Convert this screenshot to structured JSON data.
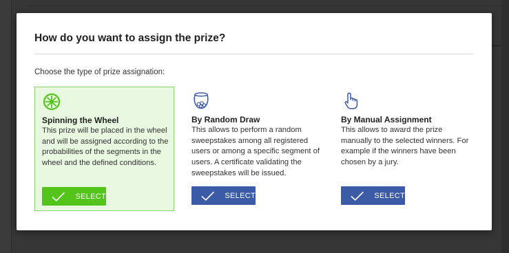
{
  "modal": {
    "title": "How do you want to assign the prize?",
    "prompt": "Choose the type of prize assignation:"
  },
  "options": [
    {
      "icon": "wheel-icon",
      "title": "Spinning the Wheel",
      "description": "This prize will be placed in the wheel and will be assigned according to the probabilities of the segments in the wheel and the defined conditions.",
      "button_label": "SELECT",
      "selected": true
    },
    {
      "icon": "draw-bowl-icon",
      "title": "By Random Draw",
      "description": "This allows to perform a random sweepstakes among all registered users or among a specific segment of users. A certificate validating the sweepstakes will be issued.",
      "button_label": "SELECT",
      "selected": false
    },
    {
      "icon": "hand-pointer-icon",
      "title": "By Manual Assignment",
      "description": "This allows to award the prize manually to the selected winners. For example if the winners have been chosen by a jury.",
      "button_label": "SELECT",
      "selected": false
    }
  ],
  "colors": {
    "selected_accent": "#52c41a",
    "selected_background": "#e8f7df",
    "selected_border": "#8bd36a",
    "button_blue": "#3b5ba7",
    "icon_blue": "#3b5ba7"
  }
}
